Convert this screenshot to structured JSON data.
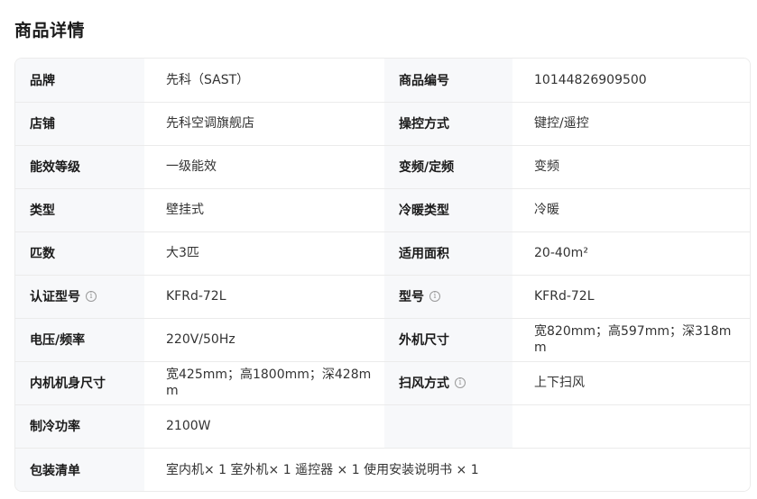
{
  "page_title": "商品详情",
  "rows": [
    {
      "label1": "品牌",
      "value1": "先科（SAST）",
      "label2": "商品编号",
      "value2": "10144826909500"
    },
    {
      "label1": "店铺",
      "value1": "先科空调旗舰店",
      "label2": "操控方式",
      "value2": "键控/遥控"
    },
    {
      "label1": "能效等级",
      "value1": "一级能效",
      "label2": "变频/定频",
      "value2": "变频"
    },
    {
      "label1": "类型",
      "value1": "壁挂式",
      "label2": "冷暖类型",
      "value2": "冷暖"
    },
    {
      "label1": "匹数",
      "value1": "大3匹",
      "label2": "适用面积",
      "value2": "20-40m²"
    },
    {
      "label1": "认证型号",
      "value1": "KFRd-72L",
      "label2": "型号",
      "value2": "KFRd-72L"
    },
    {
      "label1": "电压/频率",
      "value1": "220V/50Hz",
      "label2": "外机尺寸",
      "value2": "宽820mm；高597mm；深318mm"
    },
    {
      "label1": "内机机身尺寸",
      "value1": "宽425mm；高1800mm；深428mm",
      "label2": "扫风方式",
      "value2": "上下扫风"
    },
    {
      "label1": "制冷功率",
      "value1": "2100W",
      "label2": "",
      "value2": ""
    },
    {
      "label1": "包装清单",
      "value1": "室内机× 1 室外机× 1 遥控器 × 1 使用安装说明书 × 1"
    }
  ],
  "info_icon_glyph": "i",
  "colors": {
    "label_bg": "#f7f8fa",
    "border": "#ebebeb",
    "text": "#1a1a1a"
  }
}
